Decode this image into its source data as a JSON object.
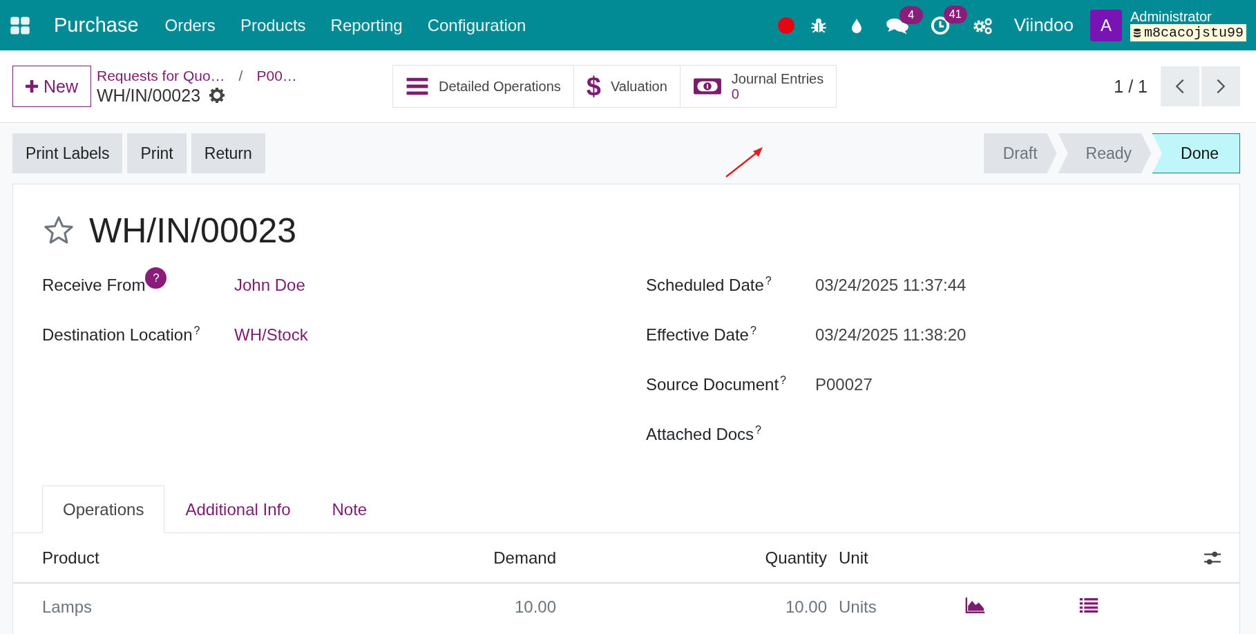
{
  "navbar": {
    "app_name": "Purchase",
    "menu": [
      "Orders",
      "Products",
      "Reporting",
      "Configuration"
    ],
    "recording": true,
    "systray": [
      {
        "kind": "bug"
      },
      {
        "kind": "drop"
      },
      {
        "kind": "chat",
        "badge": "4"
      },
      {
        "kind": "clock",
        "badge": "41"
      },
      {
        "kind": "gears"
      }
    ],
    "company": "Viindoo",
    "user": {
      "initial": "A",
      "name": "Administrator",
      "database": "m8cacojstu99"
    }
  },
  "control_panel": {
    "new_button": "New",
    "breadcrumbs": [
      "Requests for Quo…",
      "P00…"
    ],
    "breadcrumb_separator": "/",
    "record_name": "WH/IN/00023",
    "smart_buttons": [
      {
        "kind": "list",
        "label": "Detailed Operations"
      },
      {
        "kind": "dollar",
        "symbol": "$",
        "label": "Valuation"
      },
      {
        "kind": "money",
        "label": "Journal Entries",
        "count": "0"
      }
    ],
    "pager": "1 / 1"
  },
  "action_buttons": [
    "Print Labels",
    "Print",
    "Return"
  ],
  "stages": [
    {
      "label": "Draft",
      "selected": false
    },
    {
      "label": "Ready",
      "selected": false
    },
    {
      "label": "Done",
      "selected": true
    }
  ],
  "form": {
    "favorite": false,
    "title": "WH/IN/00023",
    "left_fields": [
      {
        "kind": "hint-open",
        "label": "Receive From",
        "help": "?",
        "value": "John Doe",
        "link": true
      },
      {
        "kind": "plain",
        "label": "Destination Location",
        "help": "?",
        "value": "WH/Stock",
        "link": true
      }
    ],
    "right_fields": [
      {
        "kind": "plain",
        "label": "Scheduled Date",
        "help": "?",
        "value": "03/24/2025 11:37:44",
        "link": false
      },
      {
        "kind": "plain",
        "label": "Effective Date",
        "help": "?",
        "value": "03/24/2025 11:38:20",
        "link": false
      },
      {
        "kind": "plain",
        "label": "Source Document",
        "help": "?",
        "value": "P00027",
        "link": false
      },
      {
        "kind": "plain",
        "label": "Attached Docs",
        "help": "?"
      }
    ]
  },
  "tabs": [
    {
      "label": "Operations",
      "selected": true
    },
    {
      "label": "Additional Info",
      "selected": false
    },
    {
      "label": "Note",
      "selected": false
    }
  ],
  "table": {
    "columns": [
      "Product",
      "Demand",
      "Quantity",
      "Unit"
    ],
    "rows": [
      {
        "product": "Lamps",
        "demand": "10.00",
        "quantity": "10.00",
        "unit": "Units"
      }
    ]
  }
}
